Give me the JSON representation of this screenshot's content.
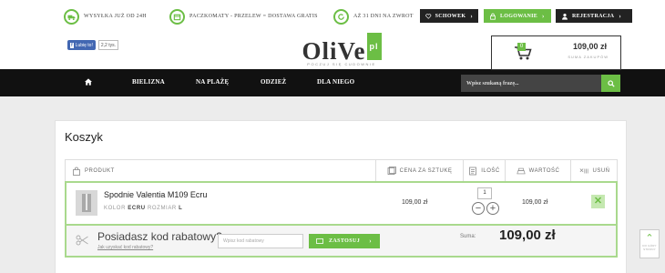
{
  "topbar": {
    "perks": [
      {
        "icon": "truck-icon",
        "label": "WYSYŁKA JUŻ OD 24H"
      },
      {
        "icon": "box-icon",
        "label": "PACZKOMATY - PRZELEW = DOSTAWA GRATIS"
      },
      {
        "icon": "refresh-icon",
        "label": "AŻ 31 DNI NA ZWROT"
      }
    ],
    "wishlist": "SCHOWEK",
    "login": "LOGOWANIE",
    "register": "REJESTRACJA"
  },
  "header": {
    "fb_like": "Lubię to!",
    "fb_count": "2,2 tys.",
    "logo_word": "OliVe",
    "logo_suffix": "pl",
    "logo_tagline": "POCZUJ SIĘ CUDOWNIE",
    "cart": {
      "count": "0",
      "total": "109,00 zł",
      "label": "SUMA ZAKUPÓW"
    }
  },
  "nav": {
    "items": [
      "BIELIZNA",
      "NA PLAŻĘ",
      "ODZIEŻ",
      "DLA NIEGO"
    ],
    "search_placeholder": "Wpisz szukaną frazę..."
  },
  "cart_page": {
    "title": "Koszyk",
    "columns": {
      "product": "PRODUKT",
      "unit_price": "CENA ZA SZTUKĘ",
      "qty": "ILOŚĆ",
      "value": "WARTOŚĆ",
      "remove": "USUŃ"
    },
    "item": {
      "name": "Spodnie Valentia M109 Ecru",
      "color_label": "KOLOR",
      "color": "ECRU",
      "size_label": "ROZMIAR",
      "size": "L",
      "unit_price": "109,00 zł",
      "qty": "1",
      "value": "109,00 zł"
    },
    "coupon": {
      "title": "Posiadasz kod rabatowy?",
      "link": "Jak uzyskać kod rabatowy?",
      "placeholder": "Wpisz kod rabatowy",
      "apply": "ZASTOSUJ"
    },
    "sum_label": "Suma:",
    "sum_value": "109,00 zł"
  },
  "scroll_top": {
    "label_1": "DO GÓRY",
    "label_2": "STRONY"
  },
  "colors": {
    "accent": "#6cbe45",
    "dark": "#111111"
  }
}
